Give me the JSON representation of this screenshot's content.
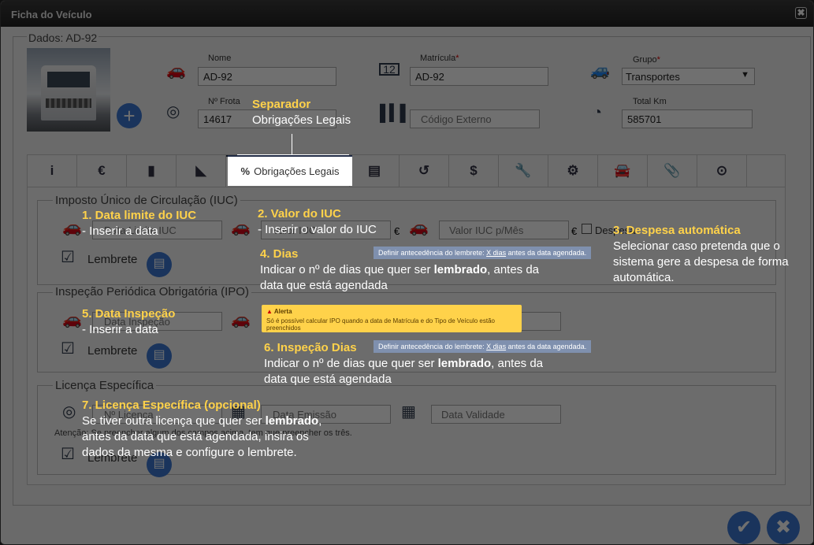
{
  "window": {
    "title": "Ficha do Veículo",
    "close_glyph": "✖"
  },
  "header": {
    "dados_label": "Dados: AD-92"
  },
  "fields": {
    "nome": {
      "label": "Nome",
      "value": "AD-92"
    },
    "matricula": {
      "label": "Matrícula",
      "required": "*",
      "value": "AD-92"
    },
    "grupo": {
      "label": "Grupo",
      "required": "*",
      "value": "Transportes"
    },
    "frota": {
      "label": "Nº Frota",
      "value": "14617"
    },
    "codigo_externo": {
      "placeholder": "Código Externo"
    },
    "total_km": {
      "label": "Total Km",
      "value": "585701"
    }
  },
  "tabs": [
    {
      "icon": "i",
      "name": "info"
    },
    {
      "icon": "€",
      "name": "euro"
    },
    {
      "icon": "▮",
      "name": "book"
    },
    {
      "icon": "◣",
      "name": "ruler"
    },
    {
      "icon": "%",
      "label": "Obrigações Legais",
      "name": "obrigacoes"
    },
    {
      "icon": "▤",
      "name": "document"
    },
    {
      "icon": "↺",
      "name": "history"
    },
    {
      "icon": "$",
      "name": "dollar"
    },
    {
      "icon": "🔧",
      "name": "wrench"
    },
    {
      "icon": "⚙",
      "name": "gear"
    },
    {
      "icon": "🚘",
      "name": "car-front"
    },
    {
      "icon": "📎",
      "name": "paperclip"
    },
    {
      "icon": "⊙",
      "name": "toggle"
    }
  ],
  "iuc": {
    "title": "Imposto Único de Circulação (IUC)",
    "data_limite_placeholder": "Data Limite IUC",
    "valor_placeholder": "Valor IUC",
    "euro": "€",
    "valor_mes_placeholder": "Valor IUC p/Mês",
    "despesa_label": "Despesa",
    "lembrete": "Lembrete"
  },
  "ipo": {
    "title": "Inspeção Periódica Obrigatória (IPO)",
    "data_placeholder": "Data Inspeção",
    "lembrete": "Lembrete"
  },
  "licenca": {
    "title": "Licença Específica",
    "numero_placeholder": "Nº Licença",
    "emissao_placeholder": "Data Emissão",
    "validade_placeholder": "Data Validade",
    "atencao": "Atenção: Se preencher algum dos campos acima, tem que preencher os três.",
    "lembrete": "Lembrete"
  },
  "notes": {
    "note1_pre": "Definir antecedência do lembrete: ",
    "note1_link": "X dias",
    "note1_post": " antes da data agendada.",
    "alert_title": "Alerta",
    "alert_text": "Só é possível calcular IPO quando a data de Matrícula e do Tipo de Veículo estão preenchidos"
  },
  "annotations": {
    "separador_title": "Separador",
    "separador_text": "Obrigações Legais",
    "a1_title": "1. Data limite do IUC",
    "a1_text": "- Inserir a data",
    "a2_title": "2. Valor do IUC",
    "a2_text": "- Inserir o valor do IUC",
    "a3_title": "3. Despesa automática",
    "a3_text": "Selecionar caso pretenda que o sistema gere a despesa de forma automática.",
    "a4_title": "4. Dias",
    "a4_pre": "Indicar o nº de dias que quer ser ",
    "a4_bold": "lembrado",
    "a4_post": ", antes da data que está agendada",
    "a5_title": "5. Data Inspeção",
    "a5_text": "- Inserir a data",
    "a6_title": "6. Inspeção Dias",
    "a6_pre": "Indicar o nº de dias que quer ser ",
    "a6_bold": "lembrado",
    "a6_post": ", antes da data que está agendada",
    "a7_title": "7. Licença Específica (opcional)",
    "a7_pre": "Se tiver outra licença que quer ser ",
    "a7_bold": "lembrado",
    "a7_post": ", antes da data que está agendada, insira os dados da mesma e configure o lembrete."
  },
  "footer": {
    "confirm_glyph": "✔",
    "cancel_glyph": "✖"
  }
}
